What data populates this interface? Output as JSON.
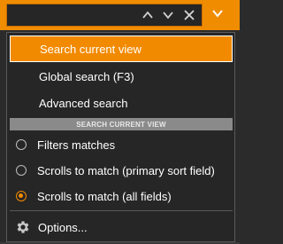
{
  "search": {
    "value": "",
    "placeholder": ""
  },
  "icons": {
    "prev": "chevron-up-icon",
    "next": "chevron-down-icon",
    "clear": "close-icon",
    "menu": "chevron-down-icon",
    "options": "gear-icon"
  },
  "colors": {
    "accent": "#f28a00",
    "background": "#262626"
  },
  "menu": {
    "items": [
      {
        "label": "Search current view",
        "active": true
      },
      {
        "label": "Global search (F3)",
        "active": false
      },
      {
        "label": "Advanced search",
        "active": false
      }
    ],
    "section_header": "SEARCH CURRENT VIEW",
    "radios": [
      {
        "label": "Filters matches",
        "checked": false
      },
      {
        "label": "Scrolls to match (primary sort field)",
        "checked": false
      },
      {
        "label": "Scrolls to match (all fields)",
        "checked": true
      }
    ],
    "options_label": "Options..."
  }
}
